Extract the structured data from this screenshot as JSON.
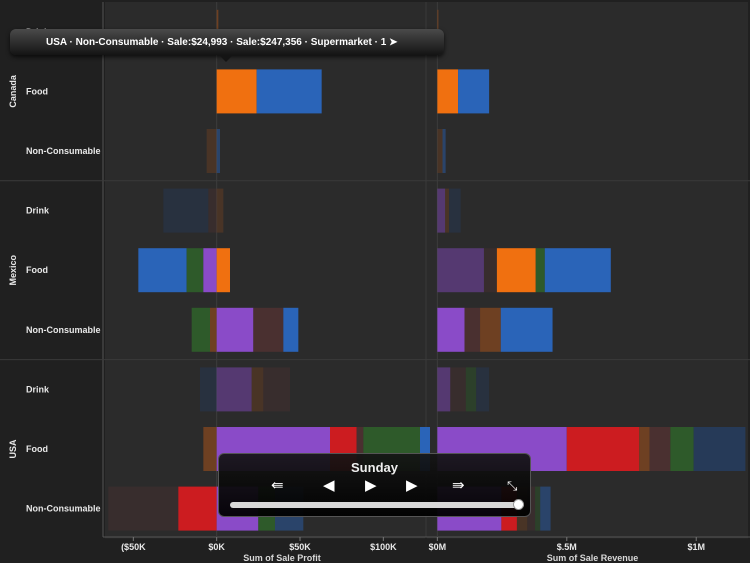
{
  "tooltip": {
    "text": "USA · Non-Consumable · Sale:$24,993 · Sale:$247,356 · Supermarket · 1  ➤"
  },
  "player": {
    "title": "Sunday",
    "first_icon": "⇚",
    "prev_icon": "◀",
    "play_icon": "▶",
    "next_icon": "▶",
    "last_icon": "⇛",
    "collapse_icon": "⤡",
    "position": 1.0
  },
  "colors": {
    "background": "#202020",
    "orange": "#f07010",
    "blue": "#2a64b8",
    "purple": "#8a4bc8",
    "red": "#cc1c20",
    "green": "#2e5a2a",
    "brown": "#6e4022",
    "navy": "#263a58",
    "darkbrown": "#4a3030"
  },
  "chart_data": {
    "type": "bar",
    "stacked": true,
    "countries": [
      "Canada",
      "Mexico",
      "USA"
    ],
    "categories": [
      "Drink",
      "Food",
      "Non-Consumable"
    ],
    "panels": [
      {
        "xlabel": "Sum of  Sale Profit",
        "tick_values": [
          -50000,
          0,
          50000,
          100000
        ],
        "tick_labels": [
          "($50K",
          "$0K",
          "$50K",
          "$100K"
        ],
        "xlim": [
          -67000,
          125000
        ]
      },
      {
        "xlabel": "Sum of  Sale Revenue",
        "tick_values": [
          0,
          500000,
          1000000
        ],
        "tick_labels": [
          "$0M",
          "$.5M",
          "$1M"
        ],
        "xlim": [
          -40000,
          1200000
        ]
      }
    ],
    "rows": [
      {
        "country": "Canada",
        "category": "Drink",
        "dim": false,
        "profit": [
          {
            "v": 1000,
            "c": "brown"
          }
        ],
        "revenue": [
          {
            "v": 4000,
            "c": "brown"
          }
        ]
      },
      {
        "country": "Canada",
        "category": "Food",
        "dim": false,
        "profit": [
          {
            "v": 24000,
            "c": "orange"
          },
          {
            "v": 39000,
            "c": "blue"
          }
        ],
        "revenue": [
          {
            "v": 80000,
            "c": "orange"
          },
          {
            "v": 120000,
            "c": "blue"
          }
        ]
      },
      {
        "country": "Canada",
        "category": "Non-Consumable",
        "dim": true,
        "profit": [
          {
            "v": -6000,
            "c": "brown"
          },
          {
            "v": 2000,
            "c": "blue"
          }
        ],
        "revenue": [
          {
            "v": 20000,
            "c": "brown"
          },
          {
            "v": 12000,
            "c": "blue"
          }
        ]
      },
      {
        "country": "Mexico",
        "category": "Drink",
        "dim": true,
        "profit": [
          {
            "v": -27000,
            "c": "navy"
          },
          {
            "v": -5000,
            "c": "darkbrown"
          },
          {
            "v": 4000,
            "c": "brown"
          }
        ],
        "revenue": [
          {
            "v": 30000,
            "c": "purple"
          },
          {
            "v": 15000,
            "c": "brown"
          },
          {
            "v": 45000,
            "c": "navy"
          }
        ]
      },
      {
        "country": "Mexico",
        "category": "Food",
        "dim": false,
        "profit": [
          {
            "v": -29000,
            "c": "blue"
          },
          {
            "v": -10000,
            "c": "green"
          },
          {
            "v": -8000,
            "c": "purple"
          },
          {
            "v": 8000,
            "c": "orange"
          }
        ],
        "revenue": [
          {
            "v": 180000,
            "c": "purple",
            "dim": true
          },
          {
            "v": 50000,
            "c": "darkbrown",
            "dim": true
          },
          {
            "v": 150000,
            "c": "orange"
          },
          {
            "v": 35000,
            "c": "green"
          },
          {
            "v": 255000,
            "c": "blue"
          }
        ]
      },
      {
        "country": "Mexico",
        "category": "Non-Consumable",
        "dim": false,
        "profit": [
          {
            "v": -11000,
            "c": "green"
          },
          {
            "v": -4000,
            "c": "brown"
          },
          {
            "v": 22000,
            "c": "purple"
          },
          {
            "v": 18000,
            "c": "darkbrown"
          },
          {
            "v": 9000,
            "c": "blue"
          }
        ],
        "revenue": [
          {
            "v": 105000,
            "c": "purple"
          },
          {
            "v": 60000,
            "c": "darkbrown"
          },
          {
            "v": 80000,
            "c": "brown"
          },
          {
            "v": 200000,
            "c": "blue"
          }
        ]
      },
      {
        "country": "USA",
        "category": "Drink",
        "dim": true,
        "profit": [
          {
            "v": -10000,
            "c": "navy"
          },
          {
            "v": 21000,
            "c": "purple"
          },
          {
            "v": 7000,
            "c": "brown"
          },
          {
            "v": 16000,
            "c": "darkbrown"
          }
        ],
        "revenue": [
          {
            "v": 50000,
            "c": "purple"
          },
          {
            "v": 60000,
            "c": "darkbrown"
          },
          {
            "v": 40000,
            "c": "green"
          },
          {
            "v": 50000,
            "c": "navy"
          }
        ]
      },
      {
        "country": "USA",
        "category": "Food",
        "dim": false,
        "profit": [
          {
            "v": -8000,
            "c": "brown"
          },
          {
            "v": 68000,
            "c": "purple"
          },
          {
            "v": 16000,
            "c": "red"
          },
          {
            "v": 4000,
            "c": "darkbrown"
          },
          {
            "v": 34000,
            "c": "green"
          },
          {
            "v": 6000,
            "c": "blue"
          }
        ],
        "revenue": [
          {
            "v": 500000,
            "c": "purple"
          },
          {
            "v": 280000,
            "c": "red"
          },
          {
            "v": 40000,
            "c": "brown"
          },
          {
            "v": 80000,
            "c": "darkbrown"
          },
          {
            "v": 90000,
            "c": "green"
          },
          {
            "v": 200000,
            "c": "navy"
          }
        ]
      },
      {
        "country": "USA",
        "category": "Non-Consumable",
        "dim": false,
        "profit": [
          {
            "v": -42000,
            "c": "darkbrown",
            "dim": true
          },
          {
            "v": -23000,
            "c": "red"
          },
          {
            "v": 24993,
            "c": "purple"
          },
          {
            "v": 10000,
            "c": "green"
          },
          {
            "v": 17000,
            "c": "blue",
            "dim": true
          }
        ],
        "revenue": [
          {
            "v": 247356,
            "c": "purple"
          },
          {
            "v": 60000,
            "c": "red"
          },
          {
            "v": 40000,
            "c": "brown",
            "dim": true
          },
          {
            "v": 30000,
            "c": "darkbrown",
            "dim": true
          },
          {
            "v": 20000,
            "c": "green",
            "dim": true
          },
          {
            "v": 40000,
            "c": "blue",
            "dim": true
          }
        ]
      }
    ]
  }
}
